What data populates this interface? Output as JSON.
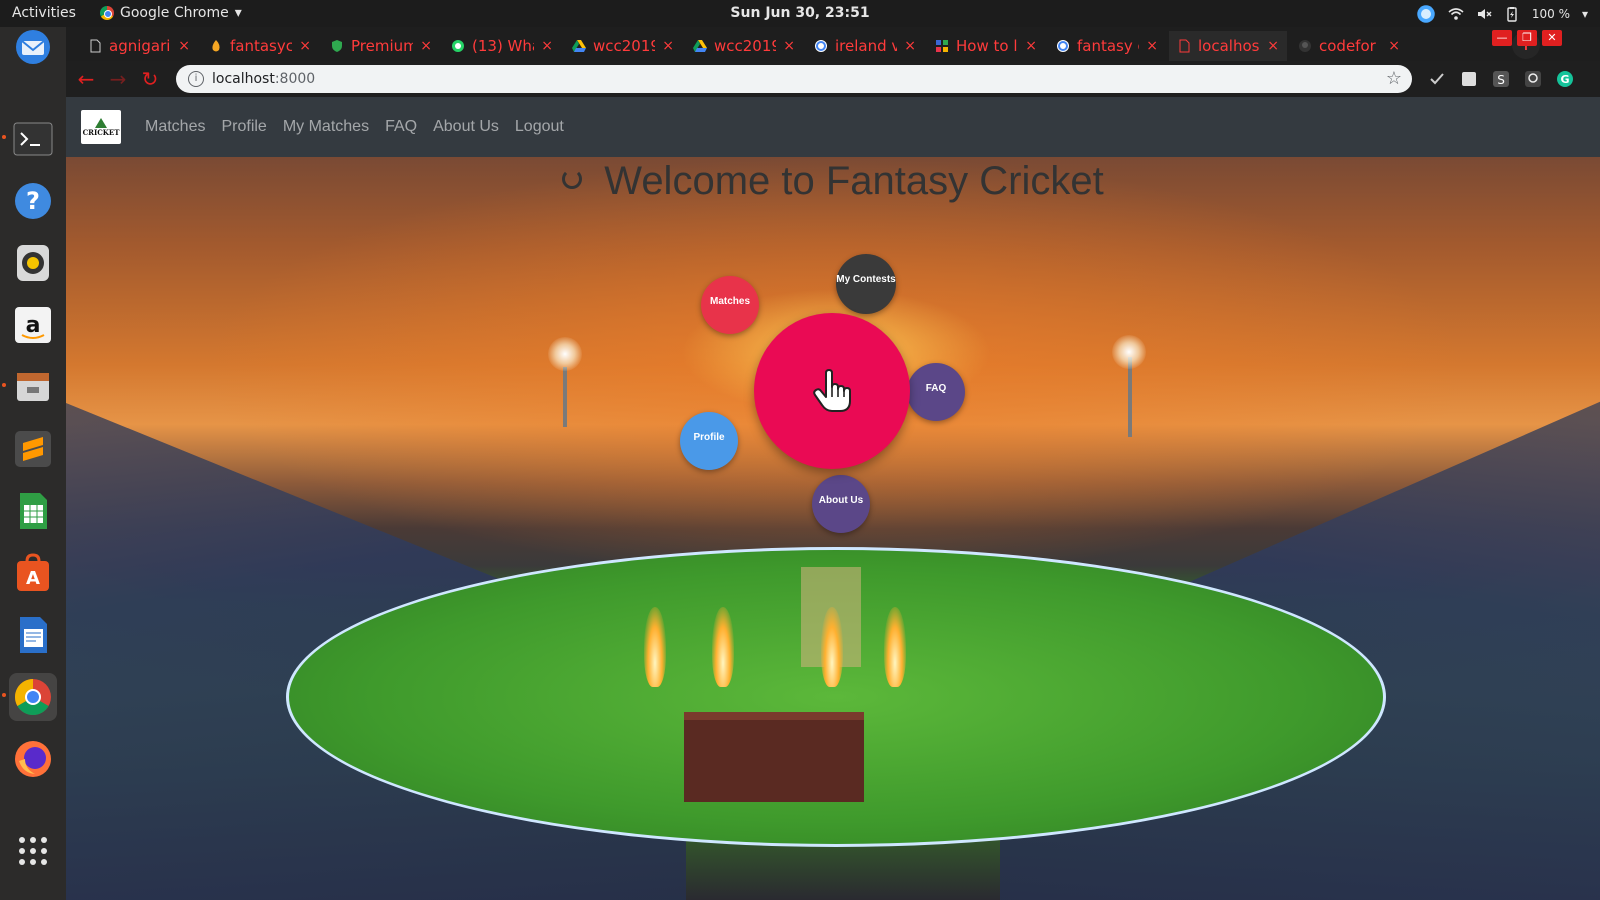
{
  "system_bar": {
    "activities": "Activities",
    "app_name": "Google Chrome",
    "app_menu_arrow": "▾",
    "clock": "Sun Jun 30, 23:51",
    "battery": "100 %",
    "menu_arrow": "▾"
  },
  "dock": {
    "items": [
      "thunderbird",
      "terminal",
      "help",
      "rhythmbox",
      "amazon",
      "files-drive",
      "sublime-text",
      "libreoffice-calc",
      "ubuntu-software",
      "libreoffice-writer",
      "google-chrome",
      "firefox",
      "app-grid"
    ]
  },
  "browser": {
    "tabs": [
      {
        "title": "agnigari",
        "icon": "document-icon"
      },
      {
        "title": "fantasyc",
        "icon": "flame-icon"
      },
      {
        "title": "Premium",
        "icon": "shield-icon"
      },
      {
        "title": "(13) Wha",
        "icon": "whatsapp-icon"
      },
      {
        "title": "wcc2019",
        "icon": "drive-icon"
      },
      {
        "title": "wcc2019",
        "icon": "drive-icon"
      },
      {
        "title": "ireland v",
        "icon": "google-icon"
      },
      {
        "title": "How to l",
        "icon": "grid-icon"
      },
      {
        "title": "fantasy c",
        "icon": "google-icon"
      },
      {
        "title": "localhos",
        "icon": "document-icon"
      },
      {
        "title": "codefor",
        "icon": "github-icon"
      }
    ],
    "tab_close": "×",
    "new_tab": "+",
    "url_host": "localhost",
    "url_port": ":8000",
    "colors": {
      "tab_text": "#ff3b3b",
      "window_bg": "#1e1e1e"
    }
  },
  "site": {
    "brand_text": "CRICKET",
    "nav": [
      "Matches",
      "Profile",
      "My Matches",
      "FAQ",
      "About Us",
      "Logout"
    ],
    "welcome_title": "Welcome to Fantasy Cricket",
    "menu_bubbles": {
      "matches": "Matches",
      "my_contests": "My Contests",
      "faq": "FAQ",
      "profile": "Profile",
      "about_us": "About Us"
    },
    "colors": {
      "navbar": "#343a40",
      "hub": "#ea0a54",
      "matches": "#e8334a",
      "my_contests": "#3a3a3a",
      "faq": "#5b4788",
      "profile": "#4a99e8",
      "about_us": "#5b4788"
    }
  }
}
